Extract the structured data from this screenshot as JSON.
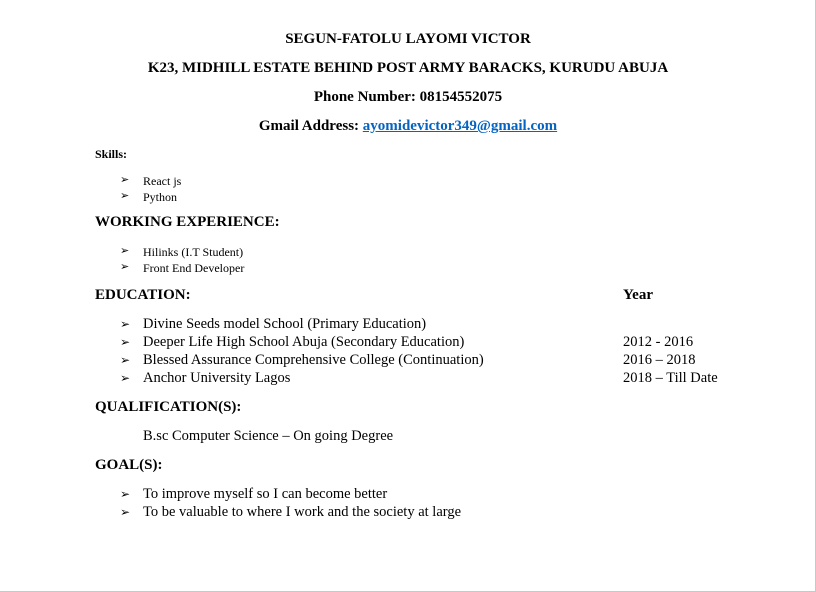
{
  "header": {
    "name": "SEGUN-FATOLU LAYOMI VICTOR",
    "address": "K23, MIDHILL ESTATE BEHIND POST ARMY BARACKS, KURUDU ABUJA",
    "phone_label": "Phone Number: 08154552075",
    "email_label": "Gmail Address: ",
    "email": "ayomidevictor349@gmail.com"
  },
  "skills": {
    "heading": "Skills:",
    "items": [
      "React js",
      "Python"
    ]
  },
  "experience": {
    "heading": "WORKING EXPERIENCE:",
    "items": [
      "Hilinks (I.T Student)",
      "Front End Developer"
    ]
  },
  "education": {
    "heading": "EDUCATION:",
    "year_heading": "Year",
    "rows": [
      {
        "school": "Divine Seeds model School (Primary Education)",
        "year": ""
      },
      {
        "school": "Deeper Life High School Abuja (Secondary Education)",
        "year": "2012 - 2016"
      },
      {
        "school": "Blessed Assurance Comprehensive College (Continuation)",
        "year": "2016 – 2018"
      },
      {
        "school": "Anchor University Lagos",
        "year": "2018 – Till Date"
      }
    ]
  },
  "qualification": {
    "heading": "QUALIFICATION(S):",
    "text": "B.sc Computer Science – On going Degree"
  },
  "goals": {
    "heading": "GOAL(S):",
    "items": [
      "To improve myself so I can become better",
      "To be valuable to where I work and the society at large"
    ]
  },
  "bullet_glyph": "➢"
}
